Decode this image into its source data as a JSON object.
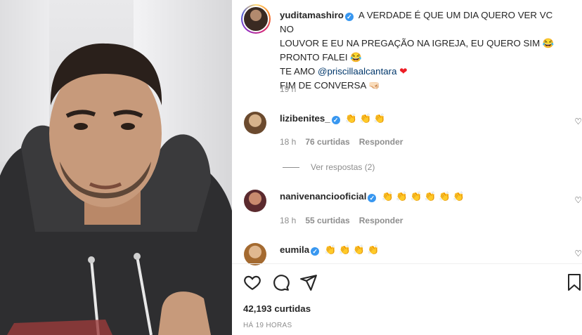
{
  "post": {
    "author": "yuditamashiro",
    "caption_lines": [
      "A VERDADE É QUE UM DIA QUERO VER VC NO",
      "LOUVOR E EU NA PREGAÇÃO NA IGREJA, EU QUERO SIM 😂",
      "PRONTO FALEI 😂",
      "TE AMO",
      "FIM DE CONVERSA 🤜🏻"
    ],
    "mention": "@priscillaalcantara",
    "heart": "❤",
    "caption_time": "19 h",
    "likes": "42,193 curtidas",
    "posted_ago": "HÁ 19 HORAS"
  },
  "comments": [
    {
      "username": "lizibenites_",
      "text": "👏 👏 👏",
      "time": "18 h",
      "likes": "76 curtidas",
      "reply": "Responder",
      "view_replies": "Ver respostas (2)"
    },
    {
      "username": "nanivenanciooficial",
      "text": "👏 👏 👏 👏 👏 👏",
      "time": "18 h",
      "likes": "55 curtidas",
      "reply": "Responder"
    },
    {
      "username": "eumila",
      "text": "👏 👏 👏 👏"
    }
  ],
  "icons": {
    "like": "heart-icon",
    "comment": "comment-icon",
    "share": "share-icon",
    "save": "bookmark-icon"
  },
  "colors": {
    "verified": "#3897f0",
    "mention": "#00376b",
    "muted": "#8e8e8e"
  }
}
